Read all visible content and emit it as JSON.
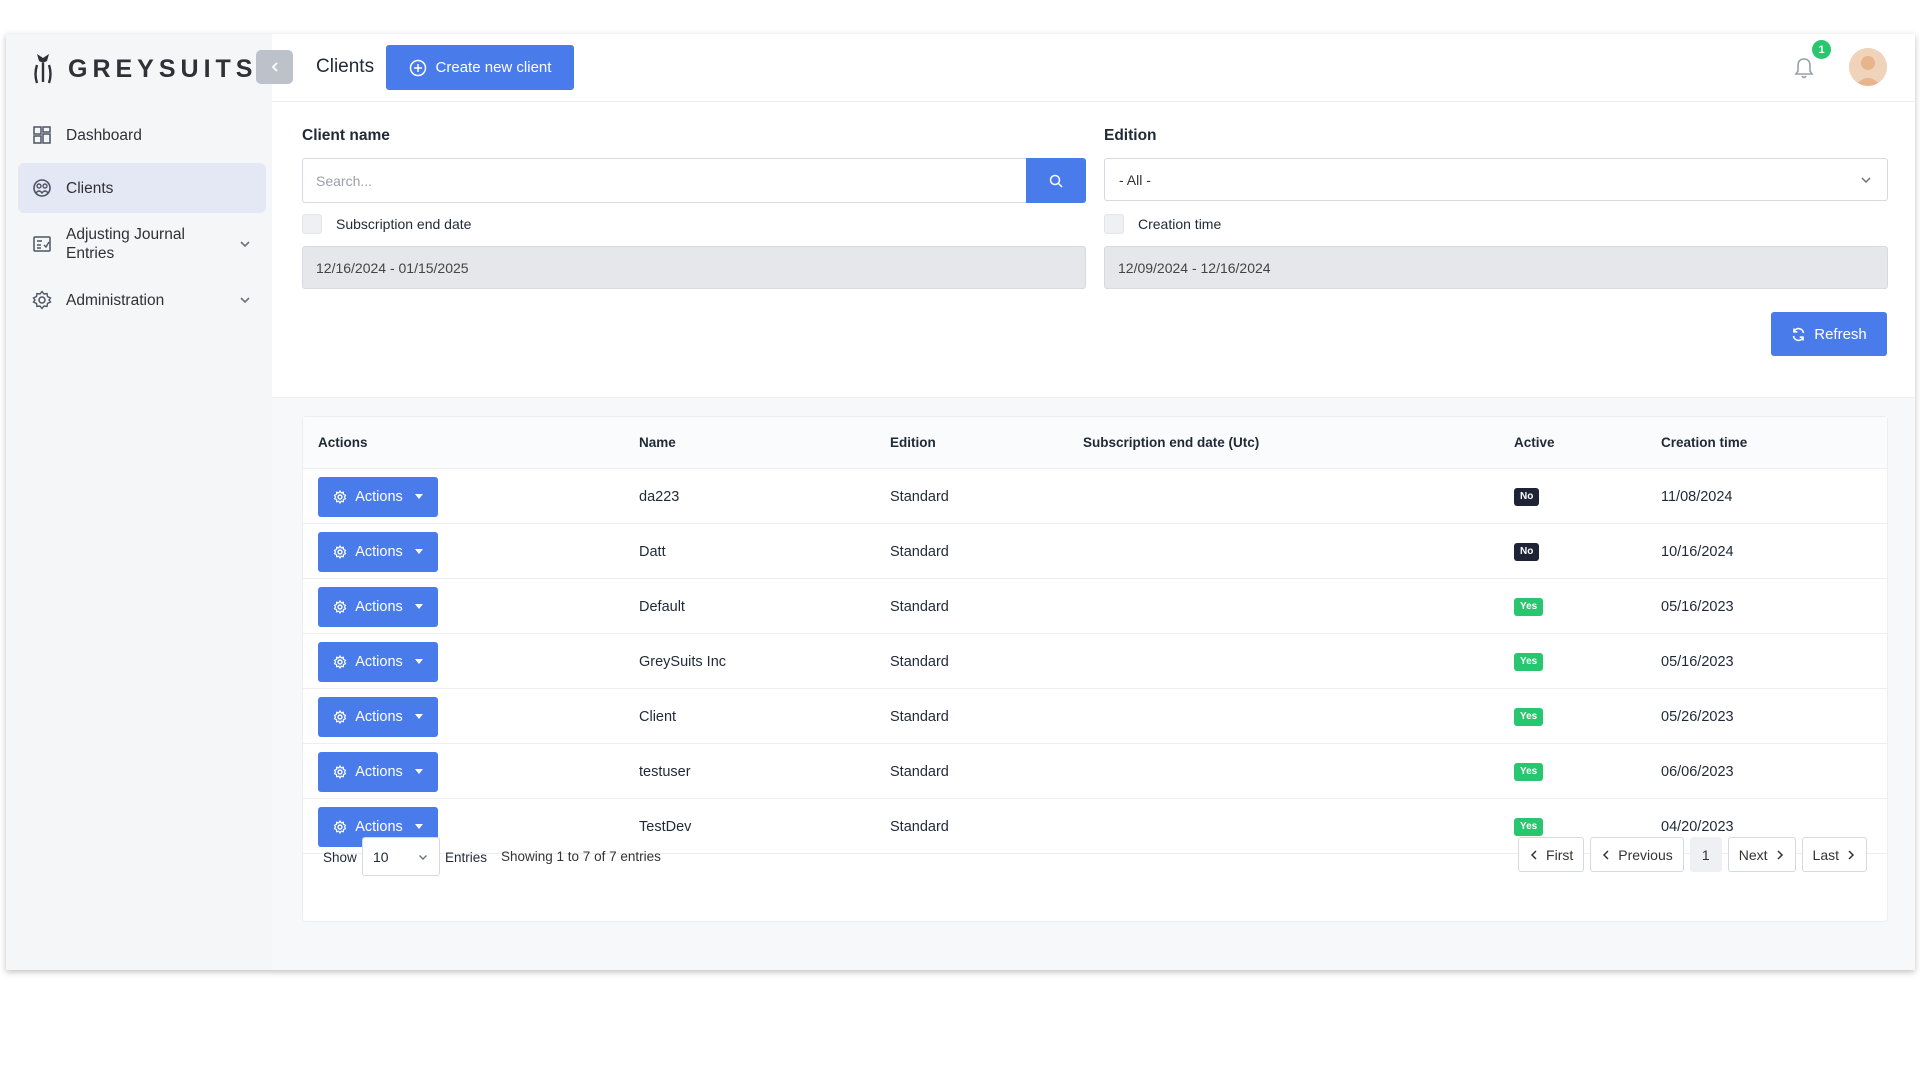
{
  "app": {
    "logo_text": "GREYSUITS"
  },
  "sidebar": {
    "items": [
      {
        "label": "Dashboard"
      },
      {
        "label": "Clients"
      },
      {
        "label": "Adjusting Journal Entries"
      },
      {
        "label": "Administration"
      }
    ]
  },
  "header": {
    "title": "Clients",
    "create_label": "Create new client",
    "notification_count": "1"
  },
  "filters": {
    "client_name_label": "Client name",
    "search_placeholder": "Search...",
    "edition_label": "Edition",
    "edition_value": "- All -",
    "subscription_label": "Subscription end date",
    "subscription_range": "12/16/2024 - 01/15/2025",
    "creation_label": "Creation time",
    "creation_range": "12/09/2024 - 12/16/2024",
    "refresh_label": "Refresh"
  },
  "table": {
    "columns": [
      "Actions",
      "Name",
      "Edition",
      "Subscription end date (Utc)",
      "Active",
      "Creation time"
    ],
    "action_label": "Actions",
    "rows": [
      {
        "name": "da223",
        "edition": "Standard",
        "subscription_end": "",
        "active": "No",
        "created": "11/08/2024"
      },
      {
        "name": "Datt",
        "edition": "Standard",
        "subscription_end": "",
        "active": "No",
        "created": "10/16/2024"
      },
      {
        "name": "Default",
        "edition": "Standard",
        "subscription_end": "",
        "active": "Yes",
        "created": "05/16/2023"
      },
      {
        "name": "GreySuits Inc",
        "edition": "Standard",
        "subscription_end": "",
        "active": "Yes",
        "created": "05/16/2023"
      },
      {
        "name": "Client",
        "edition": "Standard",
        "subscription_end": "",
        "active": "Yes",
        "created": "05/26/2023"
      },
      {
        "name": "testuser",
        "edition": "Standard",
        "subscription_end": "",
        "active": "Yes",
        "created": "06/06/2023"
      },
      {
        "name": "TestDev",
        "edition": "Standard",
        "subscription_end": "",
        "active": "Yes",
        "created": "04/20/2023"
      }
    ]
  },
  "footer": {
    "show_label": "Show",
    "page_size": "10",
    "entries_label": "Entries",
    "showing_text": "Showing 1 to 7 of 7 entries",
    "first_label": "First",
    "previous_label": "Previous",
    "current_page": "1",
    "next_label": "Next",
    "last_label": "Last"
  },
  "colors": {
    "accent": "#4a7bea",
    "active_nav": "#e3e8f4",
    "badge_yes": "#28c76f",
    "badge_no": "#1e2436"
  },
  "icons": [
    "logo-mark-icon",
    "dashboard-icon",
    "clients-icon",
    "journal-icon",
    "administration-icon",
    "chevron-down-icon",
    "chevron-left-icon",
    "plus-circle-icon",
    "bell-icon",
    "search-icon",
    "refresh-icon",
    "gear-icon",
    "chevron-right-icon"
  ]
}
